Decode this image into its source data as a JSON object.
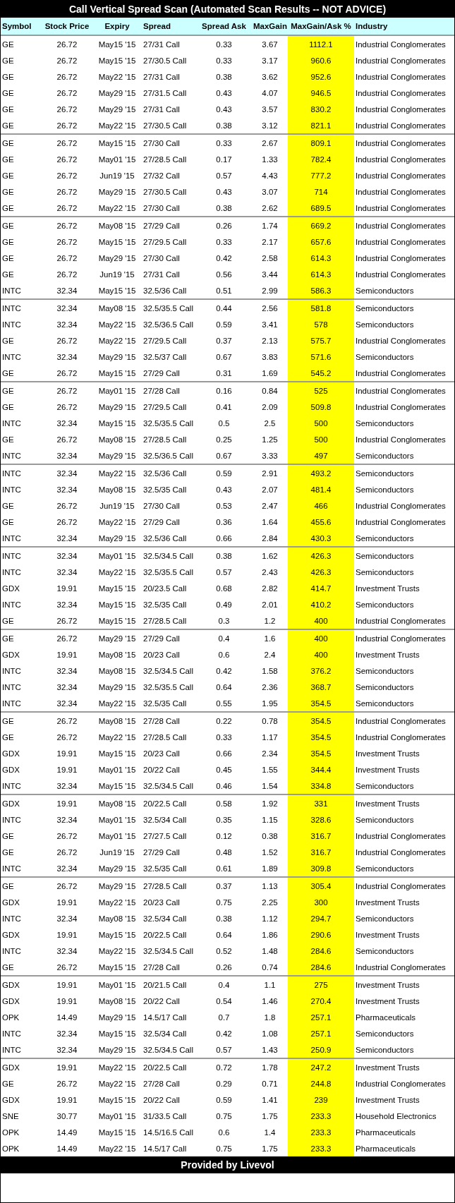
{
  "title": "Call Vertical Spread Scan (Automated Scan Results -- NOT ADVICE)",
  "table": {
    "columns": [
      "Symbol",
      "Stock Price",
      "Expiry",
      "Spread",
      "Spread Ask",
      "MaxGain",
      "MaxGain/Ask %",
      "Industry"
    ],
    "row_groups": [
      [
        [
          "GE",
          "26.72",
          "May15 '15",
          "27/31 Call",
          "0.33",
          "3.67",
          "1112.1",
          "Industrial Conglomerates"
        ],
        [
          "GE",
          "26.72",
          "May15 '15",
          "27/30.5 Call",
          "0.33",
          "3.17",
          "960.6",
          "Industrial Conglomerates"
        ],
        [
          "GE",
          "26.72",
          "May22 '15",
          "27/31 Call",
          "0.38",
          "3.62",
          "952.6",
          "Industrial Conglomerates"
        ],
        [
          "GE",
          "26.72",
          "May29 '15",
          "27/31.5 Call",
          "0.43",
          "4.07",
          "946.5",
          "Industrial Conglomerates"
        ],
        [
          "GE",
          "26.72",
          "May29 '15",
          "27/31 Call",
          "0.43",
          "3.57",
          "830.2",
          "Industrial Conglomerates"
        ],
        [
          "GE",
          "26.72",
          "May22 '15",
          "27/30.5 Call",
          "0.38",
          "3.12",
          "821.1",
          "Industrial Conglomerates"
        ]
      ],
      [
        [
          "GE",
          "26.72",
          "May15 '15",
          "27/30 Call",
          "0.33",
          "2.67",
          "809.1",
          "Industrial Conglomerates"
        ],
        [
          "GE",
          "26.72",
          "May01 '15",
          "27/28.5 Call",
          "0.17",
          "1.33",
          "782.4",
          "Industrial Conglomerates"
        ],
        [
          "GE",
          "26.72",
          "Jun19 '15",
          "27/32 Call",
          "0.57",
          "4.43",
          "777.2",
          "Industrial Conglomerates"
        ],
        [
          "GE",
          "26.72",
          "May29 '15",
          "27/30.5 Call",
          "0.43",
          "3.07",
          "714",
          "Industrial Conglomerates"
        ],
        [
          "GE",
          "26.72",
          "May22 '15",
          "27/30 Call",
          "0.38",
          "2.62",
          "689.5",
          "Industrial Conglomerates"
        ]
      ],
      [
        [
          "GE",
          "26.72",
          "May08 '15",
          "27/29 Call",
          "0.26",
          "1.74",
          "669.2",
          "Industrial Conglomerates"
        ],
        [
          "GE",
          "26.72",
          "May15 '15",
          "27/29.5 Call",
          "0.33",
          "2.17",
          "657.6",
          "Industrial Conglomerates"
        ],
        [
          "GE",
          "26.72",
          "May29 '15",
          "27/30 Call",
          "0.42",
          "2.58",
          "614.3",
          "Industrial Conglomerates"
        ],
        [
          "GE",
          "26.72",
          "Jun19 '15",
          "27/31 Call",
          "0.56",
          "3.44",
          "614.3",
          "Industrial Conglomerates"
        ],
        [
          "INTC",
          "32.34",
          "May15 '15",
          "32.5/36 Call",
          "0.51",
          "2.99",
          "586.3",
          "Semiconductors"
        ]
      ],
      [
        [
          "INTC",
          "32.34",
          "May08 '15",
          "32.5/35.5 Call",
          "0.44",
          "2.56",
          "581.8",
          "Semiconductors"
        ],
        [
          "INTC",
          "32.34",
          "May22 '15",
          "32.5/36.5 Call",
          "0.59",
          "3.41",
          "578",
          "Semiconductors"
        ],
        [
          "GE",
          "26.72",
          "May22 '15",
          "27/29.5 Call",
          "0.37",
          "2.13",
          "575.7",
          "Industrial Conglomerates"
        ],
        [
          "INTC",
          "32.34",
          "May29 '15",
          "32.5/37 Call",
          "0.67",
          "3.83",
          "571.6",
          "Semiconductors"
        ],
        [
          "GE",
          "26.72",
          "May15 '15",
          "27/29 Call",
          "0.31",
          "1.69",
          "545.2",
          "Industrial Conglomerates"
        ]
      ],
      [
        [
          "GE",
          "26.72",
          "May01 '15",
          "27/28 Call",
          "0.16",
          "0.84",
          "525",
          "Industrial Conglomerates"
        ],
        [
          "GE",
          "26.72",
          "May29 '15",
          "27/29.5 Call",
          "0.41",
          "2.09",
          "509.8",
          "Industrial Conglomerates"
        ],
        [
          "INTC",
          "32.34",
          "May15 '15",
          "32.5/35.5 Call",
          "0.5",
          "2.5",
          "500",
          "Semiconductors"
        ],
        [
          "GE",
          "26.72",
          "May08 '15",
          "27/28.5 Call",
          "0.25",
          "1.25",
          "500",
          "Industrial Conglomerates"
        ],
        [
          "INTC",
          "32.34",
          "May29 '15",
          "32.5/36.5 Call",
          "0.67",
          "3.33",
          "497",
          "Semiconductors"
        ]
      ],
      [
        [
          "INTC",
          "32.34",
          "May22 '15",
          "32.5/36 Call",
          "0.59",
          "2.91",
          "493.2",
          "Semiconductors"
        ],
        [
          "INTC",
          "32.34",
          "May08 '15",
          "32.5/35 Call",
          "0.43",
          "2.07",
          "481.4",
          "Semiconductors"
        ],
        [
          "GE",
          "26.72",
          "Jun19 '15",
          "27/30 Call",
          "0.53",
          "2.47",
          "466",
          "Industrial Conglomerates"
        ],
        [
          "GE",
          "26.72",
          "May22 '15",
          "27/29 Call",
          "0.36",
          "1.64",
          "455.6",
          "Industrial Conglomerates"
        ],
        [
          "INTC",
          "32.34",
          "May29 '15",
          "32.5/36 Call",
          "0.66",
          "2.84",
          "430.3",
          "Semiconductors"
        ]
      ],
      [
        [
          "INTC",
          "32.34",
          "May01 '15",
          "32.5/34.5 Call",
          "0.38",
          "1.62",
          "426.3",
          "Semiconductors"
        ],
        [
          "INTC",
          "32.34",
          "May22 '15",
          "32.5/35.5 Call",
          "0.57",
          "2.43",
          "426.3",
          "Semiconductors"
        ],
        [
          "GDX",
          "19.91",
          "May15 '15",
          "20/23.5 Call",
          "0.68",
          "2.82",
          "414.7",
          "Investment Trusts"
        ],
        [
          "INTC",
          "32.34",
          "May15 '15",
          "32.5/35 Call",
          "0.49",
          "2.01",
          "410.2",
          "Semiconductors"
        ],
        [
          "GE",
          "26.72",
          "May15 '15",
          "27/28.5 Call",
          "0.3",
          "1.2",
          "400",
          "Industrial Conglomerates"
        ]
      ],
      [
        [
          "GE",
          "26.72",
          "May29 '15",
          "27/29 Call",
          "0.4",
          "1.6",
          "400",
          "Industrial Conglomerates"
        ],
        [
          "GDX",
          "19.91",
          "May08 '15",
          "20/23 Call",
          "0.6",
          "2.4",
          "400",
          "Investment Trusts"
        ],
        [
          "INTC",
          "32.34",
          "May08 '15",
          "32.5/34.5 Call",
          "0.42",
          "1.58",
          "376.2",
          "Semiconductors"
        ],
        [
          "INTC",
          "32.34",
          "May29 '15",
          "32.5/35.5 Call",
          "0.64",
          "2.36",
          "368.7",
          "Semiconductors"
        ],
        [
          "INTC",
          "32.34",
          "May22 '15",
          "32.5/35 Call",
          "0.55",
          "1.95",
          "354.5",
          "Semiconductors"
        ]
      ],
      [
        [
          "GE",
          "26.72",
          "May08 '15",
          "27/28 Call",
          "0.22",
          "0.78",
          "354.5",
          "Industrial Conglomerates"
        ],
        [
          "GE",
          "26.72",
          "May22 '15",
          "27/28.5 Call",
          "0.33",
          "1.17",
          "354.5",
          "Industrial Conglomerates"
        ],
        [
          "GDX",
          "19.91",
          "May15 '15",
          "20/23 Call",
          "0.66",
          "2.34",
          "354.5",
          "Investment Trusts"
        ],
        [
          "GDX",
          "19.91",
          "May01 '15",
          "20/22 Call",
          "0.45",
          "1.55",
          "344.4",
          "Investment Trusts"
        ],
        [
          "INTC",
          "32.34",
          "May15 '15",
          "32.5/34.5 Call",
          "0.46",
          "1.54",
          "334.8",
          "Semiconductors"
        ]
      ],
      [
        [
          "GDX",
          "19.91",
          "May08 '15",
          "20/22.5 Call",
          "0.58",
          "1.92",
          "331",
          "Investment Trusts"
        ],
        [
          "INTC",
          "32.34",
          "May01 '15",
          "32.5/34 Call",
          "0.35",
          "1.15",
          "328.6",
          "Semiconductors"
        ],
        [
          "GE",
          "26.72",
          "May01 '15",
          "27/27.5 Call",
          "0.12",
          "0.38",
          "316.7",
          "Industrial Conglomerates"
        ],
        [
          "GE",
          "26.72",
          "Jun19 '15",
          "27/29 Call",
          "0.48",
          "1.52",
          "316.7",
          "Industrial Conglomerates"
        ],
        [
          "INTC",
          "32.34",
          "May29 '15",
          "32.5/35 Call",
          "0.61",
          "1.89",
          "309.8",
          "Semiconductors"
        ]
      ],
      [
        [
          "GE",
          "26.72",
          "May29 '15",
          "27/28.5 Call",
          "0.37",
          "1.13",
          "305.4",
          "Industrial Conglomerates"
        ],
        [
          "GDX",
          "19.91",
          "May22 '15",
          "20/23 Call",
          "0.75",
          "2.25",
          "300",
          "Investment Trusts"
        ],
        [
          "INTC",
          "32.34",
          "May08 '15",
          "32.5/34 Call",
          "0.38",
          "1.12",
          "294.7",
          "Semiconductors"
        ],
        [
          "GDX",
          "19.91",
          "May15 '15",
          "20/22.5 Call",
          "0.64",
          "1.86",
          "290.6",
          "Investment Trusts"
        ],
        [
          "INTC",
          "32.34",
          "May22 '15",
          "32.5/34.5 Call",
          "0.52",
          "1.48",
          "284.6",
          "Semiconductors"
        ],
        [
          "GE",
          "26.72",
          "May15 '15",
          "27/28 Call",
          "0.26",
          "0.74",
          "284.6",
          "Industrial Conglomerates"
        ]
      ],
      [
        [
          "GDX",
          "19.91",
          "May01 '15",
          "20/21.5 Call",
          "0.4",
          "1.1",
          "275",
          "Investment Trusts"
        ],
        [
          "GDX",
          "19.91",
          "May08 '15",
          "20/22 Call",
          "0.54",
          "1.46",
          "270.4",
          "Investment Trusts"
        ],
        [
          "OPK",
          "14.49",
          "May29 '15",
          "14.5/17 Call",
          "0.7",
          "1.8",
          "257.1",
          "Pharmaceuticals"
        ],
        [
          "INTC",
          "32.34",
          "May15 '15",
          "32.5/34 Call",
          "0.42",
          "1.08",
          "257.1",
          "Semiconductors"
        ],
        [
          "INTC",
          "32.34",
          "May29 '15",
          "32.5/34.5 Call",
          "0.57",
          "1.43",
          "250.9",
          "Semiconductors"
        ]
      ],
      [
        [
          "GDX",
          "19.91",
          "May22 '15",
          "20/22.5 Call",
          "0.72",
          "1.78",
          "247.2",
          "Investment Trusts"
        ],
        [
          "GE",
          "26.72",
          "May22 '15",
          "27/28 Call",
          "0.29",
          "0.71",
          "244.8",
          "Industrial Conglomerates"
        ],
        [
          "GDX",
          "19.91",
          "May15 '15",
          "20/22 Call",
          "0.59",
          "1.41",
          "239",
          "Investment Trusts"
        ],
        [
          "SNE",
          "30.77",
          "May01 '15",
          "31/33.5 Call",
          "0.75",
          "1.75",
          "233.3",
          "Household Electronics"
        ],
        [
          "OPK",
          "14.49",
          "May15 '15",
          "14.5/16.5 Call",
          "0.6",
          "1.4",
          "233.3",
          "Pharmaceuticals"
        ],
        [
          "OPK",
          "14.49",
          "May22 '15",
          "14.5/17 Call",
          "0.75",
          "1.75",
          "233.3",
          "Pharmaceuticals"
        ]
      ]
    ]
  },
  "footer": "Provided by Livevol"
}
